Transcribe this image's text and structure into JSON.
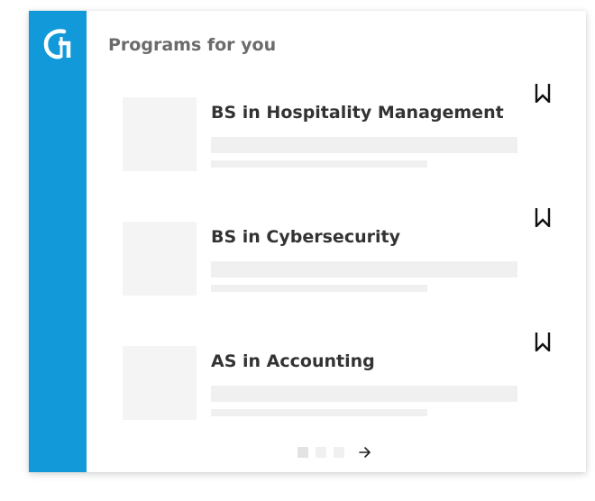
{
  "header": {
    "title": "Programs for you"
  },
  "brand": {
    "sidebar_color": "#1199d9",
    "logo_icon": "g-logo-icon"
  },
  "programs": [
    {
      "title": "BS in Hospitality Management",
      "bookmark_icon": "bookmark-icon"
    },
    {
      "title": "BS in Cybersecurity",
      "bookmark_icon": "bookmark-icon"
    },
    {
      "title": "AS in Accounting",
      "bookmark_icon": "bookmark-icon"
    }
  ],
  "pagination": {
    "pages": 3,
    "current": 1,
    "next_icon": "arrow-right-icon"
  }
}
